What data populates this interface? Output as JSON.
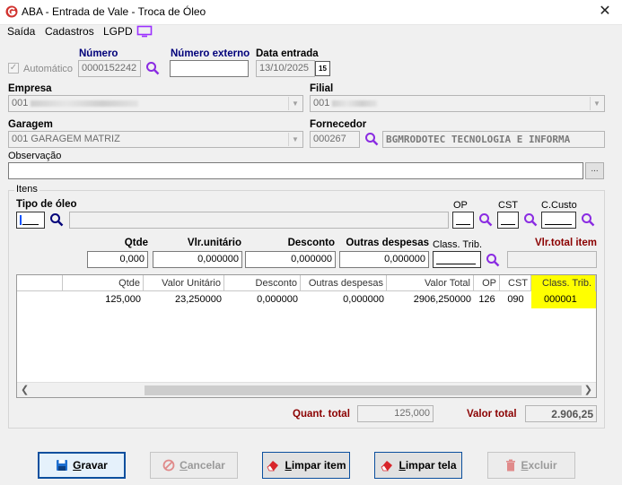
{
  "window": {
    "title": "ABA - Entrada de Vale - Troca de Óleo",
    "close_glyph": "✕"
  },
  "menu": [
    "Saída",
    "Cadastros",
    "LGPD"
  ],
  "header": {
    "automatico_label": "Automático",
    "automatico_checked": true,
    "numero_label": "Número",
    "numero_value": "0000152242",
    "numero_externo_label": "Número externo",
    "numero_externo_value": "",
    "data_entrada_label": "Data entrada",
    "data_entrada_value": "13/10/2025",
    "calendar_glyph": "15"
  },
  "empresa": {
    "label": "Empresa",
    "value": "001"
  },
  "filial": {
    "label": "Filial",
    "value": "001"
  },
  "garagem": {
    "label": "Garagem",
    "value": "001 GARAGEM MATRIZ"
  },
  "fornecedor": {
    "label": "Fornecedor",
    "code": "000267",
    "name": "BGMRODOTEC TECNOLOGIA E INFORMA"
  },
  "observacao": {
    "label": "Observação",
    "value": "",
    "button": "..."
  },
  "itens": {
    "group_label": "Itens",
    "tipo_oleo_label": "Tipo de óleo",
    "op_label": "OP",
    "cst_label": "CST",
    "ccusto_label": "C.Custo",
    "qtde_label": "Qtde",
    "qtde_value": "0,000",
    "vlr_unitario_label": "Vlr.unitário",
    "vlr_unitario_value": "0,000000",
    "desconto_label": "Desconto",
    "desconto_value": "0,000000",
    "outras_despesas_label": "Outras despesas",
    "outras_despesas_value": "0,000000",
    "class_trib_label": "Class. Trib.",
    "vlr_total_item_label": "Vlr.total item"
  },
  "grid": {
    "columns": [
      "",
      "Qtde",
      "Valor Unitário",
      "Desconto",
      "Outras despesas",
      "Valor Total",
      "OP",
      "CST",
      "Class. Trib."
    ],
    "rows": [
      [
        "",
        "125,000",
        "23,250000",
        "0,000000",
        "0,000000",
        "2906,250000",
        "126",
        "090",
        "000001"
      ]
    ]
  },
  "totals": {
    "quant_total_label": "Quant. total",
    "quant_total_value": "125,000",
    "valor_total_label": "Valor total",
    "valor_total_value": "2.906,25"
  },
  "buttons": {
    "gravar": "Gravar",
    "cancelar": "Cancelar",
    "limpar_item": "Limpar item",
    "limpar_tela": "Limpar tela",
    "excluir": "Excluir"
  },
  "colors": {
    "accent_navy": "#00007a",
    "label_red": "#8b0000",
    "highlight": "#ffff00",
    "search_purple": "#8a2be2"
  }
}
